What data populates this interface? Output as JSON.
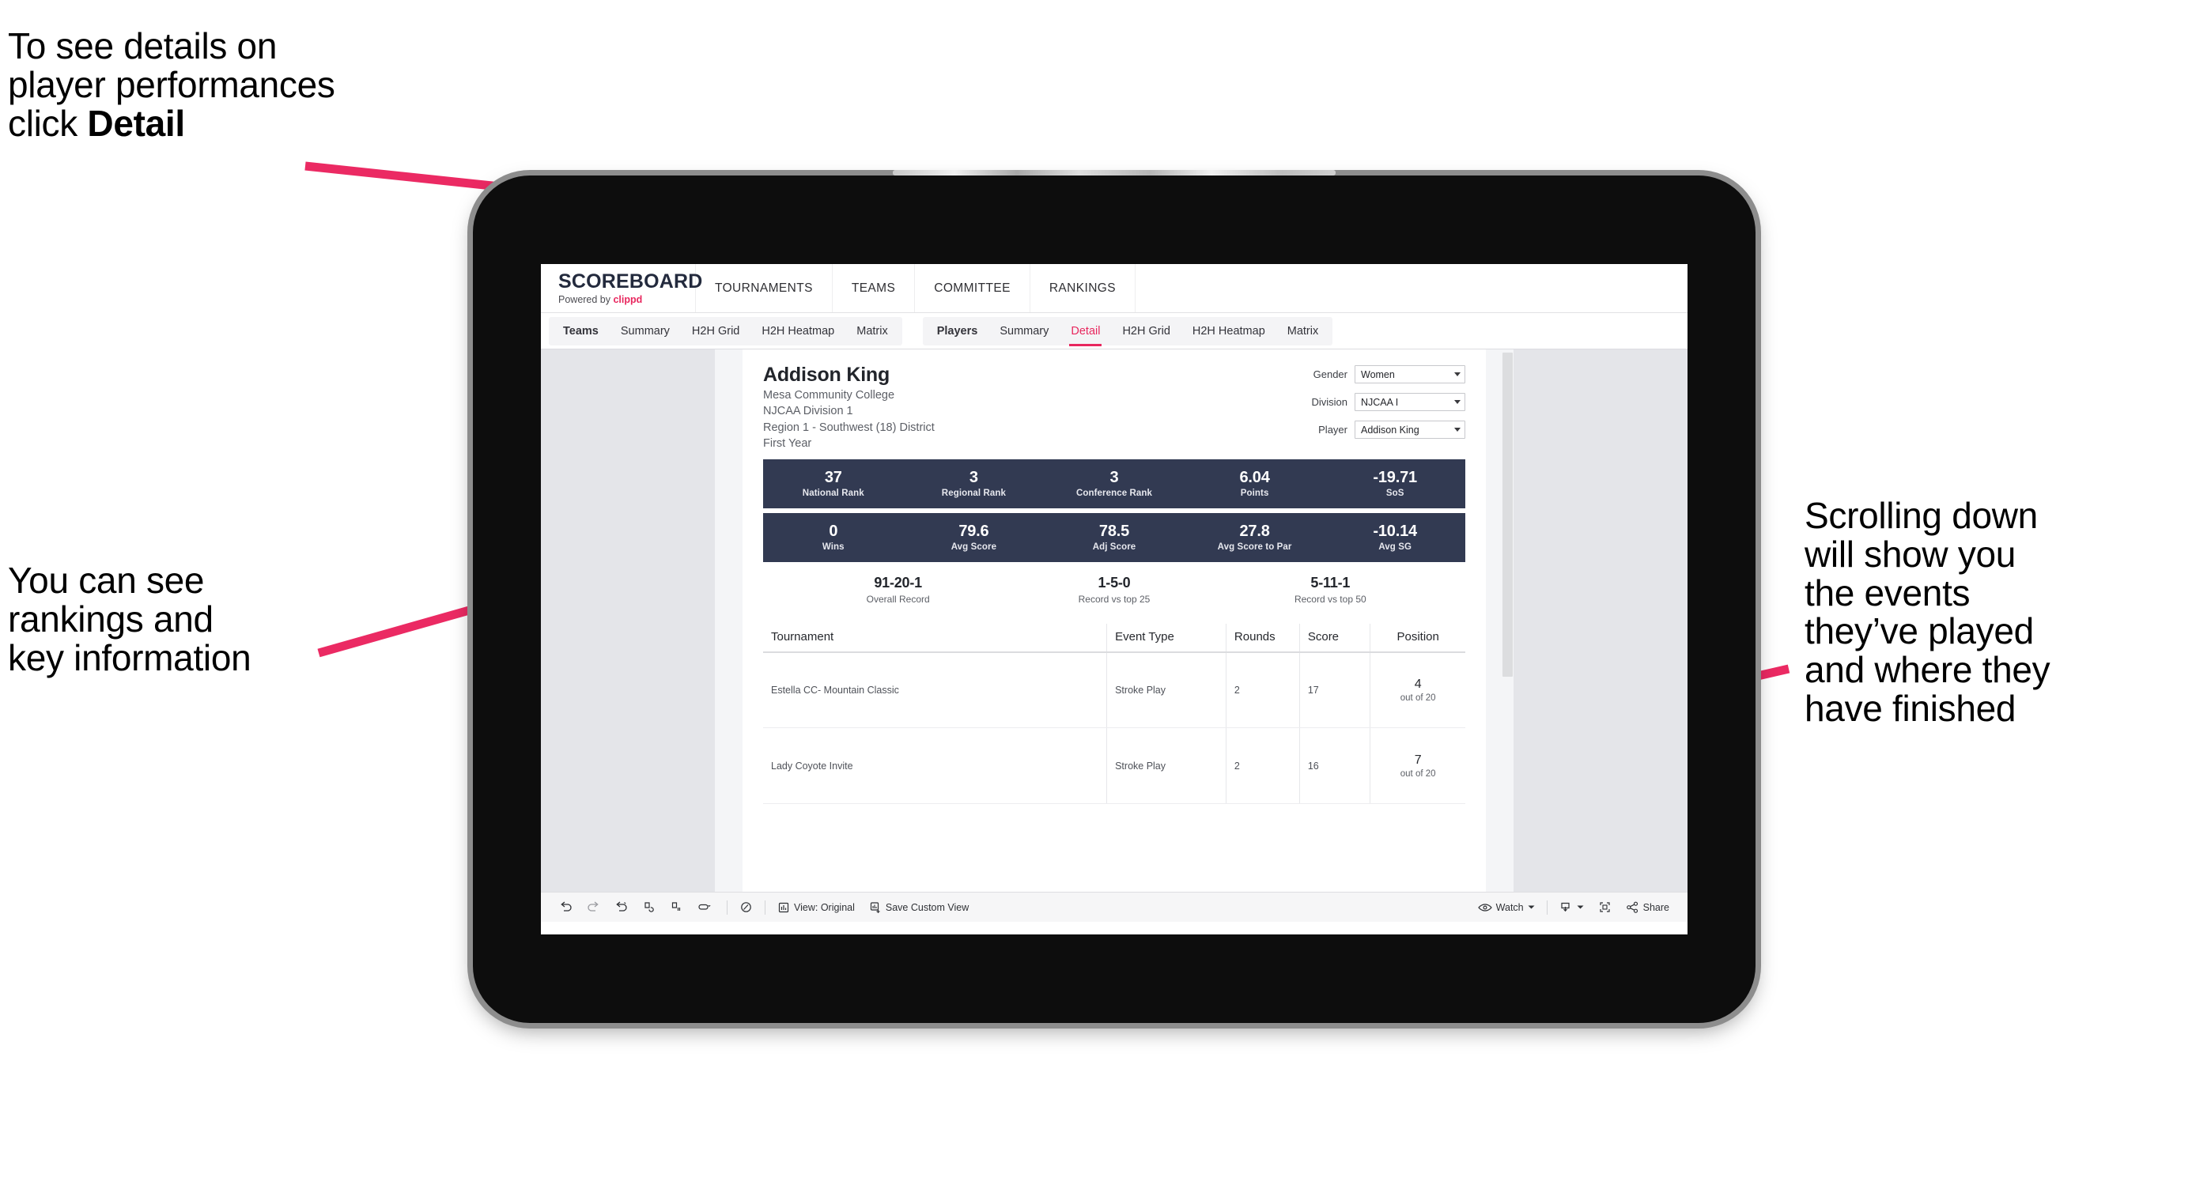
{
  "annotations": {
    "top": "To see details on\nplayer performances\nclick ",
    "top_bold": "Detail",
    "left": "You can see\nrankings and\nkey information",
    "right": "Scrolling down\nwill show you\nthe events\nthey’ve played\nand where they\nhave finished",
    "arrow_color": "#eb2a63"
  },
  "app": {
    "brand_title": "SCOREBOARD",
    "brand_powered": "Powered by ",
    "brand_name": "clippd",
    "topnav": [
      "TOURNAMENTS",
      "TEAMS",
      "COMMITTEE",
      "RANKINGS"
    ],
    "tabs_teams": [
      "Teams",
      "Summary",
      "H2H Grid",
      "H2H Heatmap",
      "Matrix"
    ],
    "tabs_players": [
      "Players",
      "Summary",
      "Detail",
      "H2H Grid",
      "H2H Heatmap",
      "Matrix"
    ],
    "active_tab": "Detail",
    "accent_color": "#e8275e"
  },
  "player": {
    "name": "Addison King",
    "school": "Mesa Community College",
    "division": "NJCAA Division 1",
    "region": "Region 1 - Southwest (18) District",
    "year": "First Year"
  },
  "filters": [
    {
      "label": "Gender",
      "value": "Women"
    },
    {
      "label": "Division",
      "value": "NJCAA I"
    },
    {
      "label": "Player",
      "value": "Addison King"
    }
  ],
  "stats_row1": [
    {
      "value": "37",
      "label": "National Rank"
    },
    {
      "value": "3",
      "label": "Regional Rank"
    },
    {
      "value": "3",
      "label": "Conference Rank"
    },
    {
      "value": "6.04",
      "label": "Points"
    },
    {
      "value": "-19.71",
      "label": "SoS"
    }
  ],
  "stats_row2": [
    {
      "value": "0",
      "label": "Wins"
    },
    {
      "value": "79.6",
      "label": "Avg Score"
    },
    {
      "value": "78.5",
      "label": "Adj Score"
    },
    {
      "value": "27.8",
      "label": "Avg Score to Par"
    },
    {
      "value": "-10.14",
      "label": "Avg SG"
    }
  ],
  "records": [
    {
      "value": "91-20-1",
      "label": "Overall Record"
    },
    {
      "value": "1-5-0",
      "label": "Record vs top 25"
    },
    {
      "value": "5-11-1",
      "label": "Record vs top 50"
    }
  ],
  "table": {
    "headers": [
      "Tournament",
      "Event Type",
      "Rounds",
      "Score",
      "Position"
    ],
    "rows": [
      {
        "tournament": "Estella CC- Mountain Classic",
        "event_type": "Stroke Play",
        "rounds": "2",
        "score": "17",
        "position": "4",
        "position_of": "out of 20"
      },
      {
        "tournament": "Lady Coyote Invite",
        "event_type": "Stroke Play",
        "rounds": "2",
        "score": "16",
        "position": "7",
        "position_of": "out of 20"
      }
    ]
  },
  "toolbar": {
    "view_label": "View: Original",
    "save_label": "Save Custom View",
    "watch_label": "Watch",
    "share_label": "Share"
  },
  "band_color": "#323a52"
}
